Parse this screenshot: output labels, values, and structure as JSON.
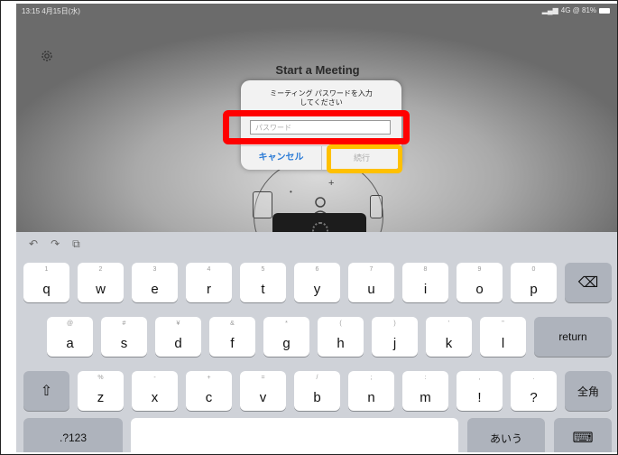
{
  "status": {
    "time": "13:15 4月15日(水)",
    "right": "4G @ 81%"
  },
  "app": {
    "title": "Start a Meeting"
  },
  "dialog": {
    "message": "ミーティング パスワードを入力してください",
    "password_placeholder": "パスワード",
    "cancel": "キャンセル",
    "go": "続行"
  },
  "keyboard": {
    "tools": [
      "↶",
      "↷",
      "⧉"
    ],
    "row1": [
      {
        "m": "q",
        "s": "1"
      },
      {
        "m": "w",
        "s": "2"
      },
      {
        "m": "e",
        "s": "3"
      },
      {
        "m": "r",
        "s": "4"
      },
      {
        "m": "t",
        "s": "5"
      },
      {
        "m": "y",
        "s": "6"
      },
      {
        "m": "u",
        "s": "7"
      },
      {
        "m": "i",
        "s": "8"
      },
      {
        "m": "o",
        "s": "9"
      },
      {
        "m": "p",
        "s": "0"
      }
    ],
    "row2": [
      {
        "m": "a",
        "s": "@"
      },
      {
        "m": "s",
        "s": "#"
      },
      {
        "m": "d",
        "s": "¥"
      },
      {
        "m": "f",
        "s": "&"
      },
      {
        "m": "g",
        "s": "*"
      },
      {
        "m": "h",
        "s": "("
      },
      {
        "m": "j",
        "s": ")"
      },
      {
        "m": "k",
        "s": "'"
      },
      {
        "m": "l",
        "s": "\""
      }
    ],
    "row3": [
      {
        "m": "z",
        "s": "%"
      },
      {
        "m": "x",
        "s": "-"
      },
      {
        "m": "c",
        "s": "+"
      },
      {
        "m": "v",
        "s": "="
      },
      {
        "m": "b",
        "s": "/"
      },
      {
        "m": "n",
        "s": ";"
      },
      {
        "m": "m",
        "s": ":"
      },
      {
        "m": "!",
        "s": ","
      },
      {
        "m": "?",
        "s": "."
      }
    ],
    "return": "return",
    "zenkaku": "全角",
    "num": ".?123",
    "kana": "あいう",
    "backspace_icon": "⌫",
    "shift_icon": "⇧",
    "keyboard_icon": "⌨"
  }
}
